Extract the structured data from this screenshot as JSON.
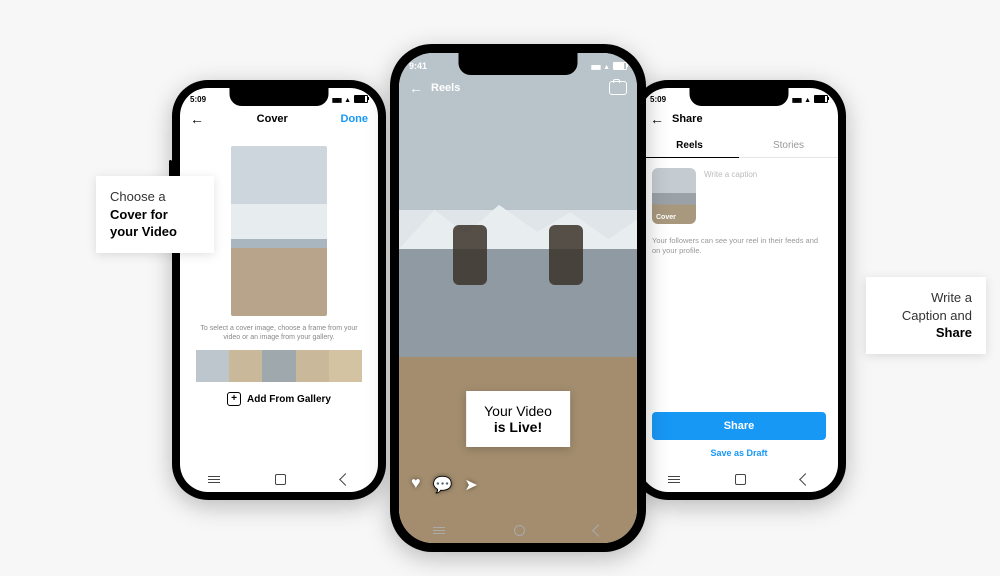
{
  "status": {
    "time_side": "5:09",
    "time_center": "9:41"
  },
  "left_phone": {
    "header": {
      "title": "Cover",
      "done": "Done"
    },
    "help_text": "To select a cover image, choose a frame from your video or an image from your gallery.",
    "add_from_gallery": "Add From Gallery"
  },
  "center_phone": {
    "header": {
      "title": "Reels"
    },
    "live_line1": "Your Video",
    "live_line2": "is Live!"
  },
  "right_phone": {
    "header": {
      "title": "Share"
    },
    "tabs": {
      "reels": "Reels",
      "stories": "Stories"
    },
    "cover_label": "Cover",
    "caption_placeholder": "Write a caption",
    "visibility_note": "Your followers can see your reel in their feeds and on your profile.",
    "share_button": "Share",
    "save_draft": "Save as Draft"
  },
  "annotations": {
    "left_l1": "Choose a",
    "left_l2": "Cover for",
    "left_l3": "your Video",
    "right_l1": "Write a",
    "right_l2": "Caption and",
    "right_l3": "Share"
  }
}
